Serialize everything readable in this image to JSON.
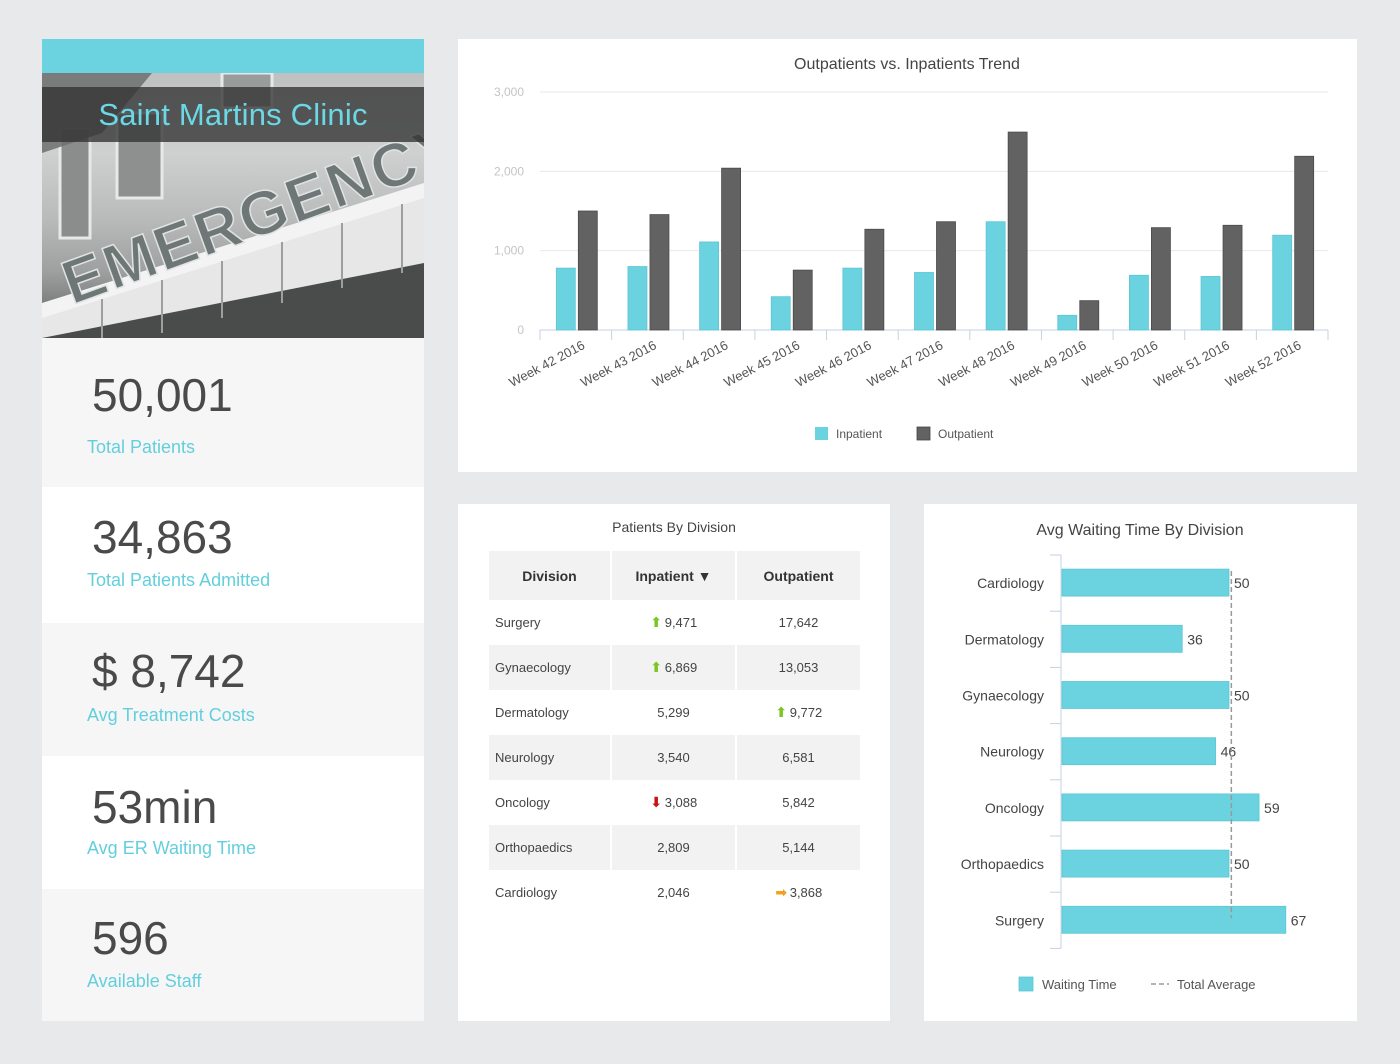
{
  "clinic": {
    "name": "Saint Martins Clinic",
    "photo_caption": "EMERGENCY"
  },
  "kpis": [
    {
      "value": "50,001",
      "label": "Total Patients"
    },
    {
      "value": "34,863",
      "label": "Total Patients Admitted"
    },
    {
      "value": "$ 8,742",
      "label": "Avg Treatment Costs"
    },
    {
      "value": "53min",
      "label": "Avg ER Waiting Time"
    },
    {
      "value": "596",
      "label": "Available Staff"
    }
  ],
  "colors": {
    "accent": "#6bd2df",
    "inpatient": "#6bd2df",
    "outpatient": "#626262",
    "trend_up": "#7cc623",
    "trend_down": "#cc1111",
    "trend_flat": "#f3a01b"
  },
  "chart_data": [
    {
      "type": "bar",
      "title": "Outpatients vs. Inpatients Trend",
      "xlabel": "",
      "ylabel": "",
      "categories": [
        "Week 42 2016",
        "Week 43 2016",
        "Week 44 2016",
        "Week 45 2016",
        "Week 46 2016",
        "Week 47 2016",
        "Week 48 2016",
        "Week 49 2016",
        "Week 50 2016",
        "Week 51 2016",
        "Week 52 2016"
      ],
      "series": [
        {
          "name": "Inpatient",
          "values": [
            780,
            800,
            1110,
            420,
            780,
            725,
            1365,
            185,
            690,
            675,
            1195
          ]
        },
        {
          "name": "Outpatient",
          "values": [
            1500,
            1455,
            2040,
            755,
            1270,
            1365,
            2495,
            370,
            1290,
            1320,
            2190
          ]
        }
      ],
      "ylim": [
        0,
        3000
      ],
      "yticks": [
        "0",
        "1,000",
        "2,000",
        "3,000"
      ],
      "ytick_values": [
        0,
        1000,
        2000,
        3000
      ],
      "grid": true,
      "legend_position": "bottom"
    },
    {
      "type": "bar",
      "orientation": "horizontal",
      "title": "Avg Waiting Time By Division",
      "categories": [
        "Cardiology",
        "Dermatology",
        "Gynaecology",
        "Neurology",
        "Oncology",
        "Orthopaedics",
        "Surgery"
      ],
      "series": [
        {
          "name": "Waiting Time",
          "values": [
            50,
            36,
            50,
            46,
            59,
            50,
            67
          ]
        }
      ],
      "reference_line": {
        "name": "Total Average",
        "value": 51
      },
      "xlim": [
        0,
        80
      ],
      "grid": false,
      "legend_position": "bottom"
    }
  ],
  "division_table": {
    "title": "Patients By Division",
    "columns": [
      "Division",
      "Inpatient ▼",
      "Outpatient"
    ],
    "rows": [
      {
        "division": "Surgery",
        "inpatient": "9,471",
        "inpatient_trend": "up",
        "outpatient": "17,642",
        "outpatient_trend": ""
      },
      {
        "division": "Gynaecology",
        "inpatient": "6,869",
        "inpatient_trend": "up",
        "outpatient": "13,053",
        "outpatient_trend": ""
      },
      {
        "division": "Dermatology",
        "inpatient": "5,299",
        "inpatient_trend": "",
        "outpatient": "9,772",
        "outpatient_trend": "up"
      },
      {
        "division": "Neurology",
        "inpatient": "3,540",
        "inpatient_trend": "",
        "outpatient": "6,581",
        "outpatient_trend": ""
      },
      {
        "division": "Oncology",
        "inpatient": "3,088",
        "inpatient_trend": "down",
        "outpatient": "5,842",
        "outpatient_trend": ""
      },
      {
        "division": "Orthopaedics",
        "inpatient": "2,809",
        "inpatient_trend": "",
        "outpatient": "5,144",
        "outpatient_trend": ""
      },
      {
        "division": "Cardiology",
        "inpatient": "2,046",
        "inpatient_trend": "",
        "outpatient": "3,868",
        "outpatient_trend": "right"
      }
    ]
  }
}
